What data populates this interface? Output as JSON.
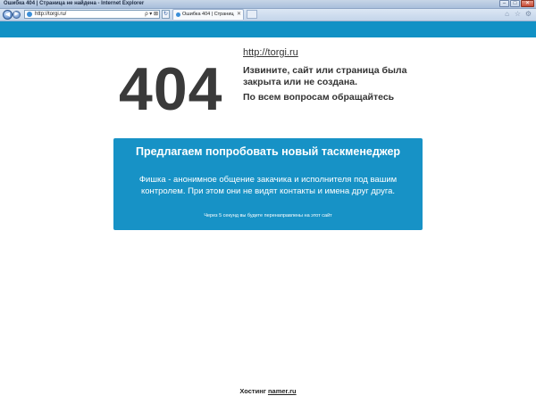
{
  "window": {
    "title": "Ошибка 404 | Страница не найдена - Internet Explorer",
    "min_symbol": "–",
    "max_symbol": "□",
    "close_symbol": "✕"
  },
  "browser": {
    "url": "http://torgi.ru/",
    "address_tools": "ρ ▾ ⊠",
    "refresh_symbol": "↻",
    "back_symbol": "◀",
    "forward_symbol": "▶",
    "tab_label": "Ошибка 404 | Страница не ...",
    "tab_close": "✕",
    "toolbar_icons": [
      "home-icon",
      "favorites-icon",
      "tools-icon"
    ]
  },
  "page": {
    "site_link": "http://torgi.ru",
    "error_code": "404",
    "message": "Извините, сайт или страница была закрыта или не создана.",
    "contact": "По всем вопросам обращайтесь",
    "promo": {
      "title": "Предлагаем попробовать новый таскменеджер",
      "text": "Фишка - анонимное общение закачика и исполнителя под вашим контролем. При этом они не видят контакты и имена друг друга.",
      "note": "Через 5 секунд вы будете перенаправлены на этот сайт"
    },
    "footer": {
      "label": "Хостинг",
      "link": "namer.ru"
    }
  },
  "colors": {
    "accent": "#1191c5",
    "promo_bg": "#1792c6",
    "text": "#333333"
  }
}
